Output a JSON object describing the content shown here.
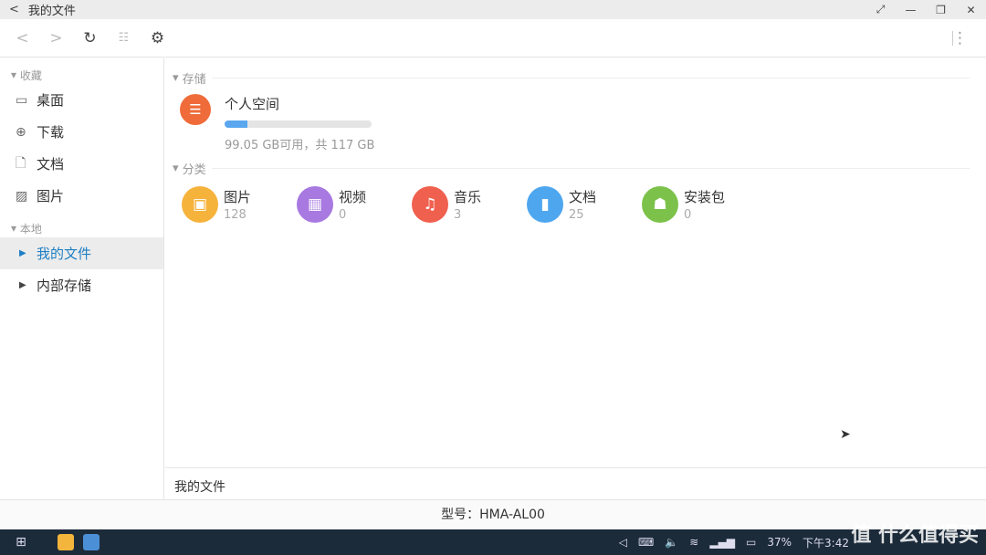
{
  "window": {
    "title": "我的文件"
  },
  "sidebar": {
    "sections": [
      {
        "label": "收藏",
        "items": [
          {
            "label": "桌面",
            "icon": "desktop-icon"
          },
          {
            "label": "下载",
            "icon": "download-icon"
          },
          {
            "label": "文档",
            "icon": "document-icon"
          },
          {
            "label": "图片",
            "icon": "image-icon"
          }
        ]
      },
      {
        "label": "本地",
        "items": [
          {
            "label": "我的文件",
            "active": true
          },
          {
            "label": "内部存储"
          }
        ]
      }
    ]
  },
  "main": {
    "storage_header": "存储",
    "storage": {
      "name": "个人空间",
      "used_fraction": 0.153,
      "summary": "99.05 GB可用，共 117 GB",
      "color": "#ef6c3a"
    },
    "category_header": "分类",
    "categories": [
      {
        "name": "图片",
        "count": "128",
        "color": "#f6b33c",
        "icon": "image-icon"
      },
      {
        "name": "视频",
        "count": "0",
        "color": "#a879e0",
        "icon": "film-icon"
      },
      {
        "name": "音乐",
        "count": "3",
        "color": "#f0604e",
        "icon": "music-icon"
      },
      {
        "name": "文档",
        "count": "25",
        "color": "#4ea6ef",
        "icon": "document-icon"
      },
      {
        "name": "安装包",
        "count": "0",
        "color": "#7cc24a",
        "icon": "android-icon"
      }
    ]
  },
  "statusbar": {
    "path": "我的文件"
  },
  "footer": {
    "model": "型号：HMA-AL00"
  },
  "taskbar": {
    "battery": "37%",
    "time": "下午3:42"
  },
  "watermark": "值 什么值得买"
}
